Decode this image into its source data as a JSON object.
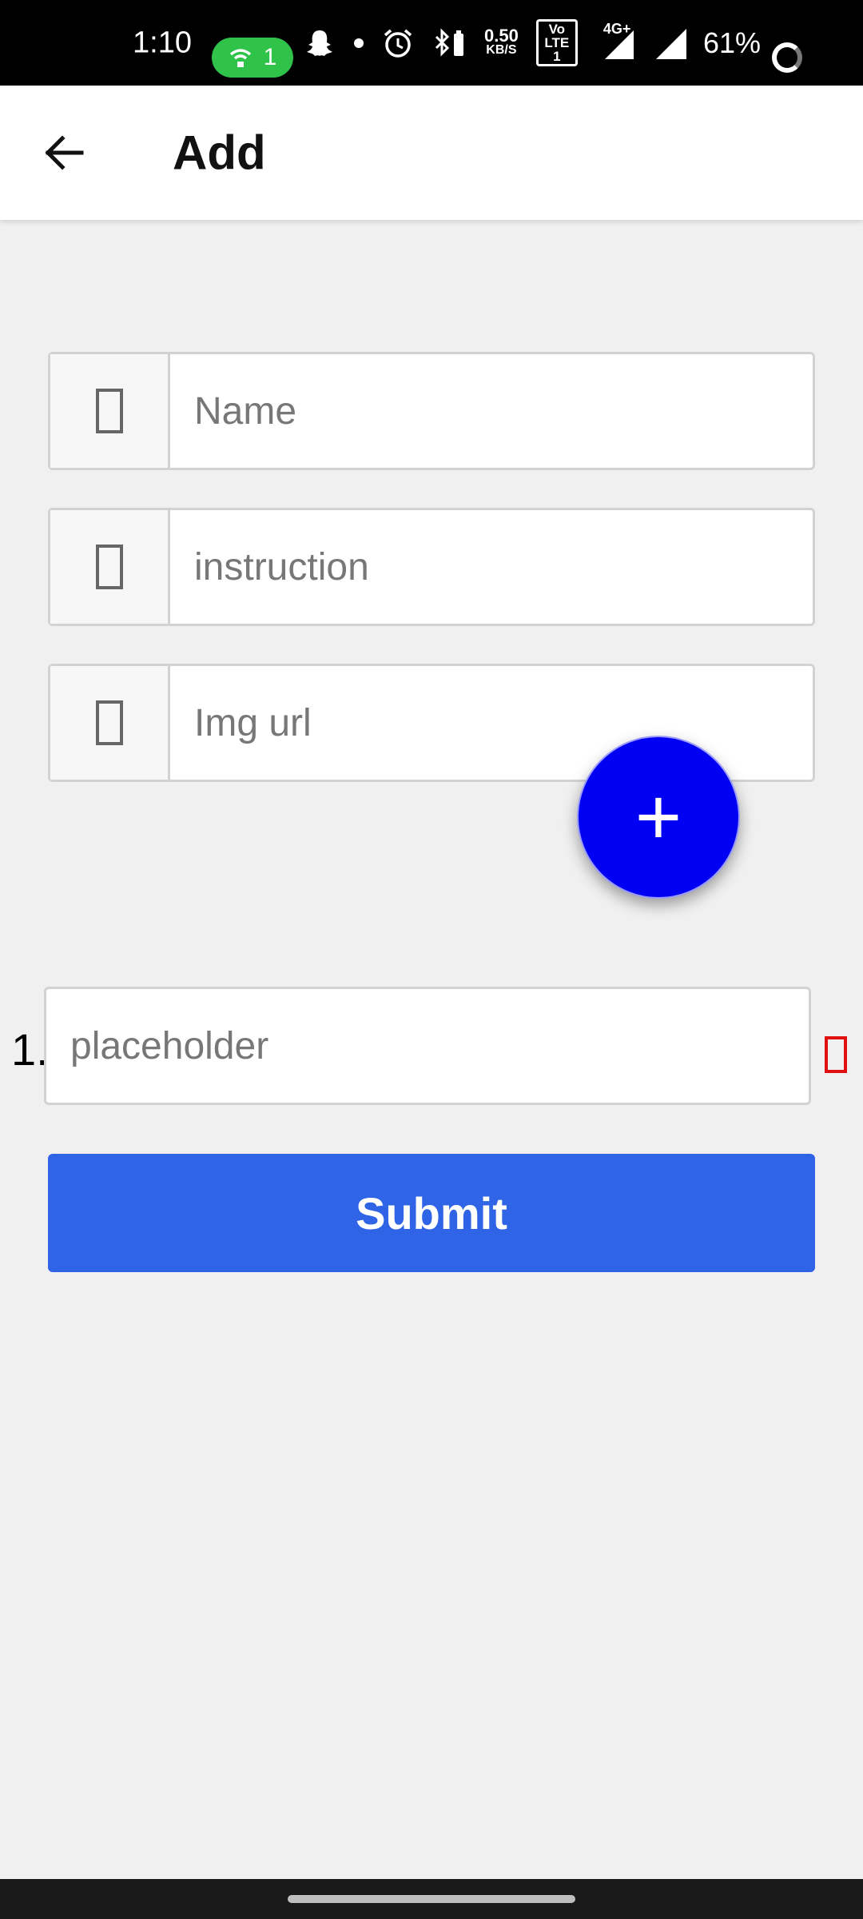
{
  "status_bar": {
    "time": "1:10",
    "wifi_count": "1",
    "net_speed_value": "0.50",
    "net_speed_unit": "KB/S",
    "volte": "Vo LTE 1",
    "network_type": "4G+",
    "battery": "61%"
  },
  "app_bar": {
    "title": "Add"
  },
  "form": {
    "name_placeholder": "Name",
    "instruction_placeholder": "instruction",
    "img_url_placeholder": "Img url"
  },
  "steps": [
    {
      "number": "1.",
      "placeholder": "placeholder"
    }
  ],
  "fab_label": "+",
  "submit_label": "Submit",
  "colors": {
    "fab": "#0000f2",
    "submit": "#2f64e6",
    "delete": "#e01010",
    "background": "#f0f0f0"
  },
  "icons": {
    "back": "arrow-left-icon",
    "field_prefix": "placeholder-glyph-icon",
    "delete": "delete-icon"
  }
}
